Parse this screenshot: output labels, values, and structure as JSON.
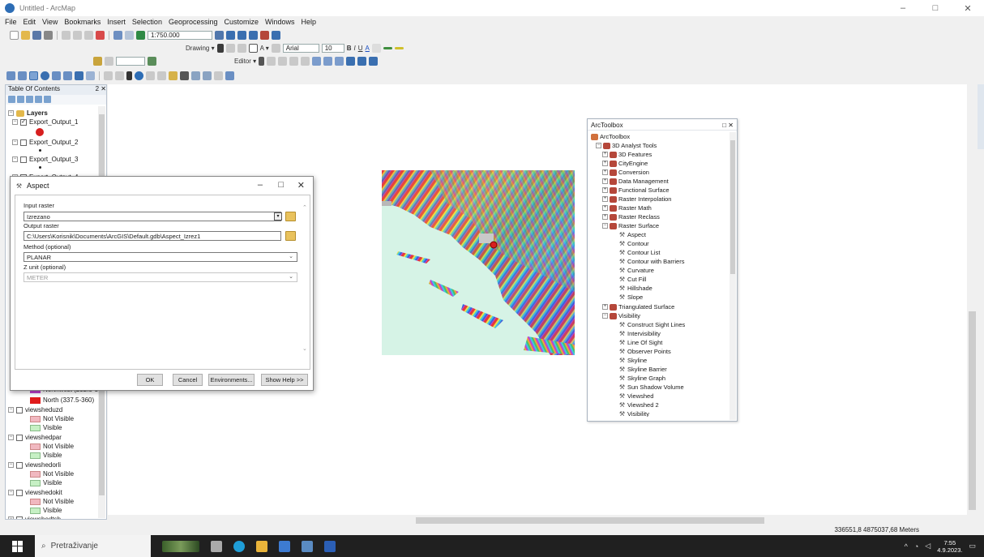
{
  "window": {
    "title": "Untitled - ArcMap",
    "controls": [
      "–",
      "□",
      "✕"
    ]
  },
  "menu": [
    "File",
    "Edit",
    "View",
    "Bookmarks",
    "Insert",
    "Selection",
    "Geoprocessing",
    "Customize",
    "Windows",
    "Help"
  ],
  "toolbar": {
    "scale": "1:750.000",
    "drawing_label": "Drawing ▾",
    "font": "Arial",
    "font_size": "10",
    "editor_label": "Editor ▾"
  },
  "toc": {
    "title": "Table Of Contents",
    "pin": "2 ✕",
    "root": "Layers",
    "layers": [
      {
        "name": "Export_Output_1",
        "checked": true
      },
      {
        "name": "Export_Output_2",
        "checked": false
      },
      {
        "name": "Export_Output_3",
        "checked": false
      },
      {
        "name": "Export_Output_4",
        "checked": false
      }
    ],
    "lower": {
      "northwest_label": "Northwest (292.5-3",
      "north_label": "North (337.5-360)",
      "viewshed_layers": [
        {
          "name": "viewsheduzd",
          "not_visible": "Not Visible",
          "visible": "Visible"
        },
        {
          "name": "viewshedpar",
          "not_visible": "Not Visible",
          "visible": "Visible"
        },
        {
          "name": "viewshedorli",
          "not_visible": "Not Visible",
          "visible": "Visible"
        },
        {
          "name": "viewshedokit",
          "not_visible": "Not Visible",
          "visible": "Visible"
        }
      ],
      "last_partial": "viewshedtsh"
    }
  },
  "aspect_dialog": {
    "title": "Aspect",
    "input_raster_label": "Input raster",
    "input_raster_value": "Izrezano",
    "output_raster_label": "Output raster",
    "output_raster_value": "C:\\Users\\Korisnik\\Documents\\ArcGIS\\Default.gdb\\Aspect_Izrez1",
    "method_label": "Method (optional)",
    "method_value": "PLANAR",
    "zunit_label": "Z unit (optional)",
    "zunit_value": "METER",
    "buttons": {
      "ok": "OK",
      "cancel": "Cancel",
      "environments": "Environments...",
      "show_help": "Show Help >>"
    }
  },
  "arctoolbox": {
    "title": "ArcToolbox",
    "root": "ArcToolbox",
    "analyst": "3D Analyst Tools",
    "toolsets": [
      "3D Features",
      "CityEngine",
      "Conversion",
      "Data Management",
      "Functional Surface",
      "Raster Interpolation",
      "Raster Math",
      "Raster Reclass",
      "Raster Surface"
    ],
    "raster_surface_tools": [
      "Aspect",
      "Contour",
      "Contour List",
      "Contour with Barriers",
      "Curvature",
      "Cut Fill",
      "Hillshade",
      "Slope"
    ],
    "more_toolsets": [
      "Triangulated Surface",
      "Visibility"
    ],
    "visibility_tools": [
      "Construct Sight Lines",
      "Intervisibility",
      "Line Of Sight",
      "Observer Points",
      "Skyline",
      "Skyline Barrier",
      "Skyline Graph",
      "Sun Shadow Volume",
      "Viewshed",
      "Viewshed 2",
      "Visibility"
    ]
  },
  "status": {
    "coords": "336551,8  4875037,68 Meters"
  },
  "taskbar": {
    "search_placeholder": "Pretraživanje",
    "time": "7:55",
    "date": "4.9.2023."
  },
  "colors": {
    "accent": "#2d6db5",
    "north_swatch": "#e01b1b",
    "northwest_swatch": "#c03fd0",
    "not_visible_swatch": "#f1b8c0",
    "visible_swatch": "#c6f0c4",
    "raster_background": "#d6f3e6"
  }
}
